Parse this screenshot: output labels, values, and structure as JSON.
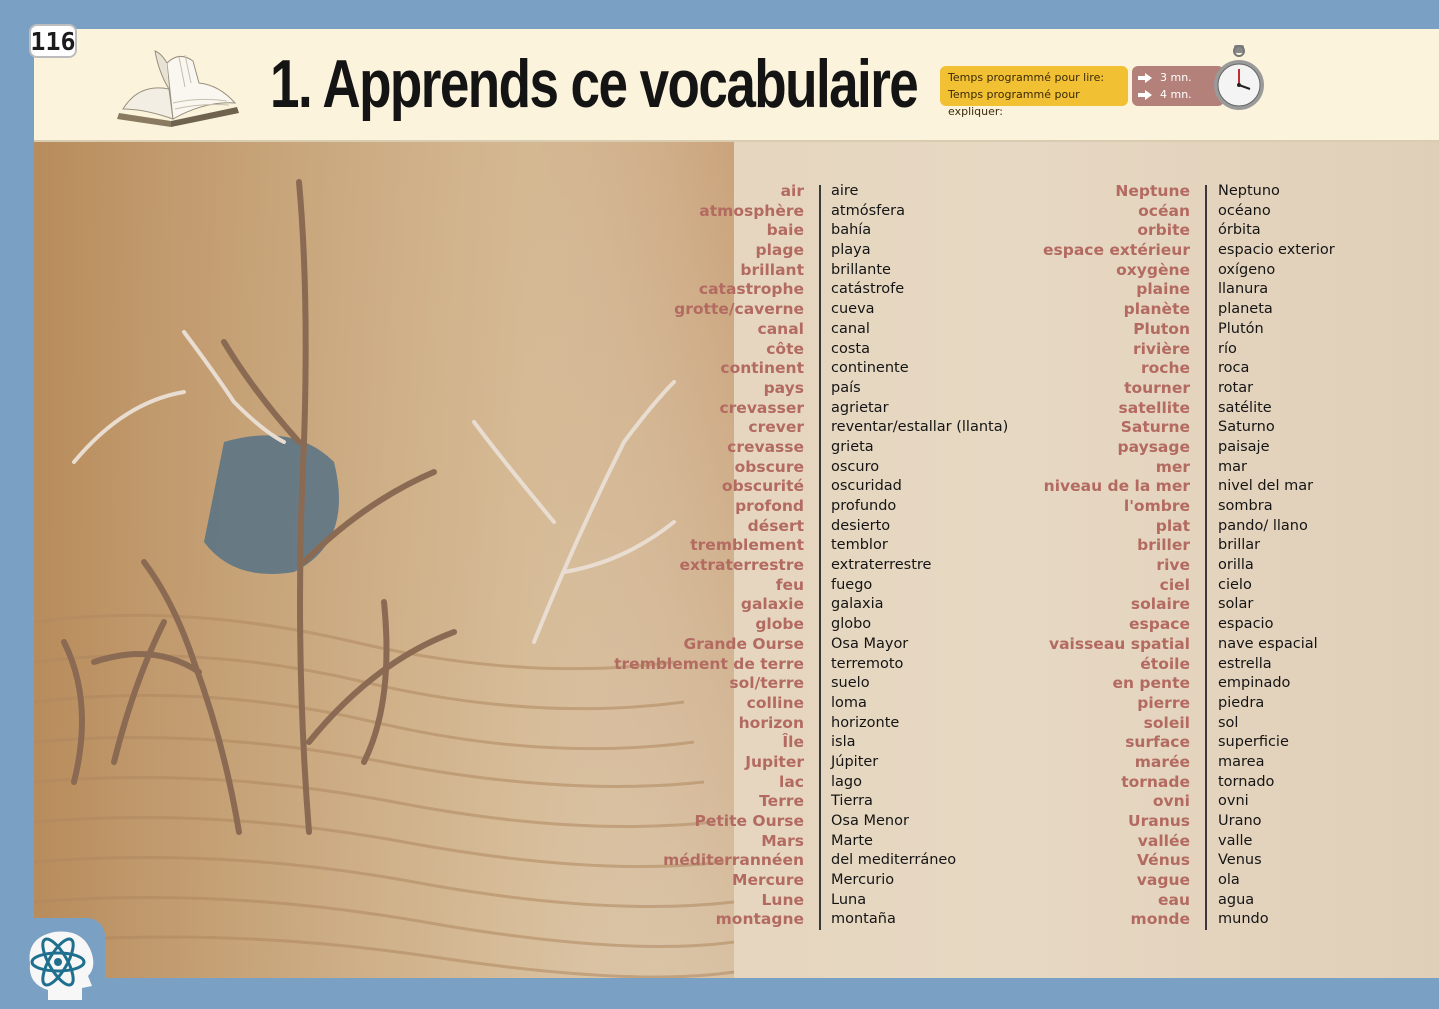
{
  "page_number": "116",
  "title": "1. Apprends ce vocabulaire",
  "timer": {
    "read_label": "Temps programmé pour lire:",
    "explain_label": "Temps programmé pour expliquer:",
    "read_value": "3 mn.",
    "explain_value": "4 mn.",
    "colors": {
      "label_bg": "#f2c033",
      "value_bg": "#b4817a"
    }
  },
  "icons": [
    "open-book-icon",
    "stopwatch-icon",
    "arrow-right-icon",
    "brain-atom-icon"
  ],
  "colors": {
    "french_word": "#b36a61",
    "spanish_word": "#151515",
    "frame": "#7aa0c4",
    "header_bg": "#fbf3dc"
  },
  "vocab_left": {
    "french": [
      "air",
      "atmosphère",
      "baie",
      "plage",
      "brillant",
      "catastrophe",
      "grotte/caverne",
      "canal",
      "côte",
      "continent",
      "pays",
      "crevasser",
      "crever",
      "crevasse",
      "obscure",
      "obscurité",
      "profond",
      "désert",
      "tremblement",
      "extraterrestre",
      "feu",
      "galaxie",
      "globe",
      "Grande  Ourse",
      "tremblement de terre",
      "sol/terre",
      "colline",
      "horizon",
      "Île",
      "Jupiter",
      "lac",
      "Terre",
      "Petite Ourse",
      "Mars",
      "méditerrannéen",
      "Mercure",
      "Lune",
      "montagne"
    ],
    "spanish": [
      "aire",
      "atmósfera",
      "bahía",
      "playa",
      "brillante",
      "catástrofe",
      "cueva",
      "canal",
      "costa",
      "continente",
      "país",
      "agrietar",
      "reventar/estallar (llanta)",
      "grieta",
      "oscuro",
      "oscuridad",
      "profundo",
      "desierto",
      "temblor",
      "extraterrestre",
      "fuego",
      "galaxia",
      "globo",
      "Osa Mayor",
      "terremoto",
      "suelo",
      "loma",
      "horizonte",
      "isla",
      "Júpiter",
      "lago",
      "Tierra",
      "Osa Menor",
      "Marte",
      "del mediterráneo",
      "Mercurio",
      "Luna",
      "montaña"
    ]
  },
  "vocab_right": {
    "french": [
      "Neptune",
      "océan",
      "orbite",
      "espace extérieur",
      "oxygène",
      "plaine",
      "planète",
      "Pluton",
      "rivière",
      "roche",
      "tourner",
      "satellite",
      "Saturne",
      "paysage",
      "mer",
      "niveau de la mer",
      "l'ombre",
      "plat",
      "briller",
      "rive",
      "ciel",
      "solaire",
      "espace",
      "vaisseau spatial",
      "étoile",
      "en pente",
      "pierre",
      "soleil",
      "surface",
      "marée",
      "tornade",
      "ovni",
      "Uranus",
      "vallée",
      "Vénus",
      "vague",
      "eau",
      "monde"
    ],
    "spanish": [
      "Neptuno",
      "océano",
      "órbita",
      "espacio exterior",
      "oxígeno",
      "llanura",
      "planeta",
      "Plutón",
      "río",
      "roca",
      "rotar",
      "satélite",
      "Saturno",
      "paisaje",
      "mar",
      "nivel del mar",
      "sombra",
      "pando/ llano",
      "brillar",
      "orilla",
      "cielo",
      "solar",
      "espacio",
      "nave espacial",
      "estrella",
      "empinado",
      "piedra",
      "sol",
      "superficie",
      "marea",
      "tornado",
      "ovni",
      "Urano",
      "valle",
      "Venus",
      "ola",
      "agua",
      "mundo"
    ]
  }
}
